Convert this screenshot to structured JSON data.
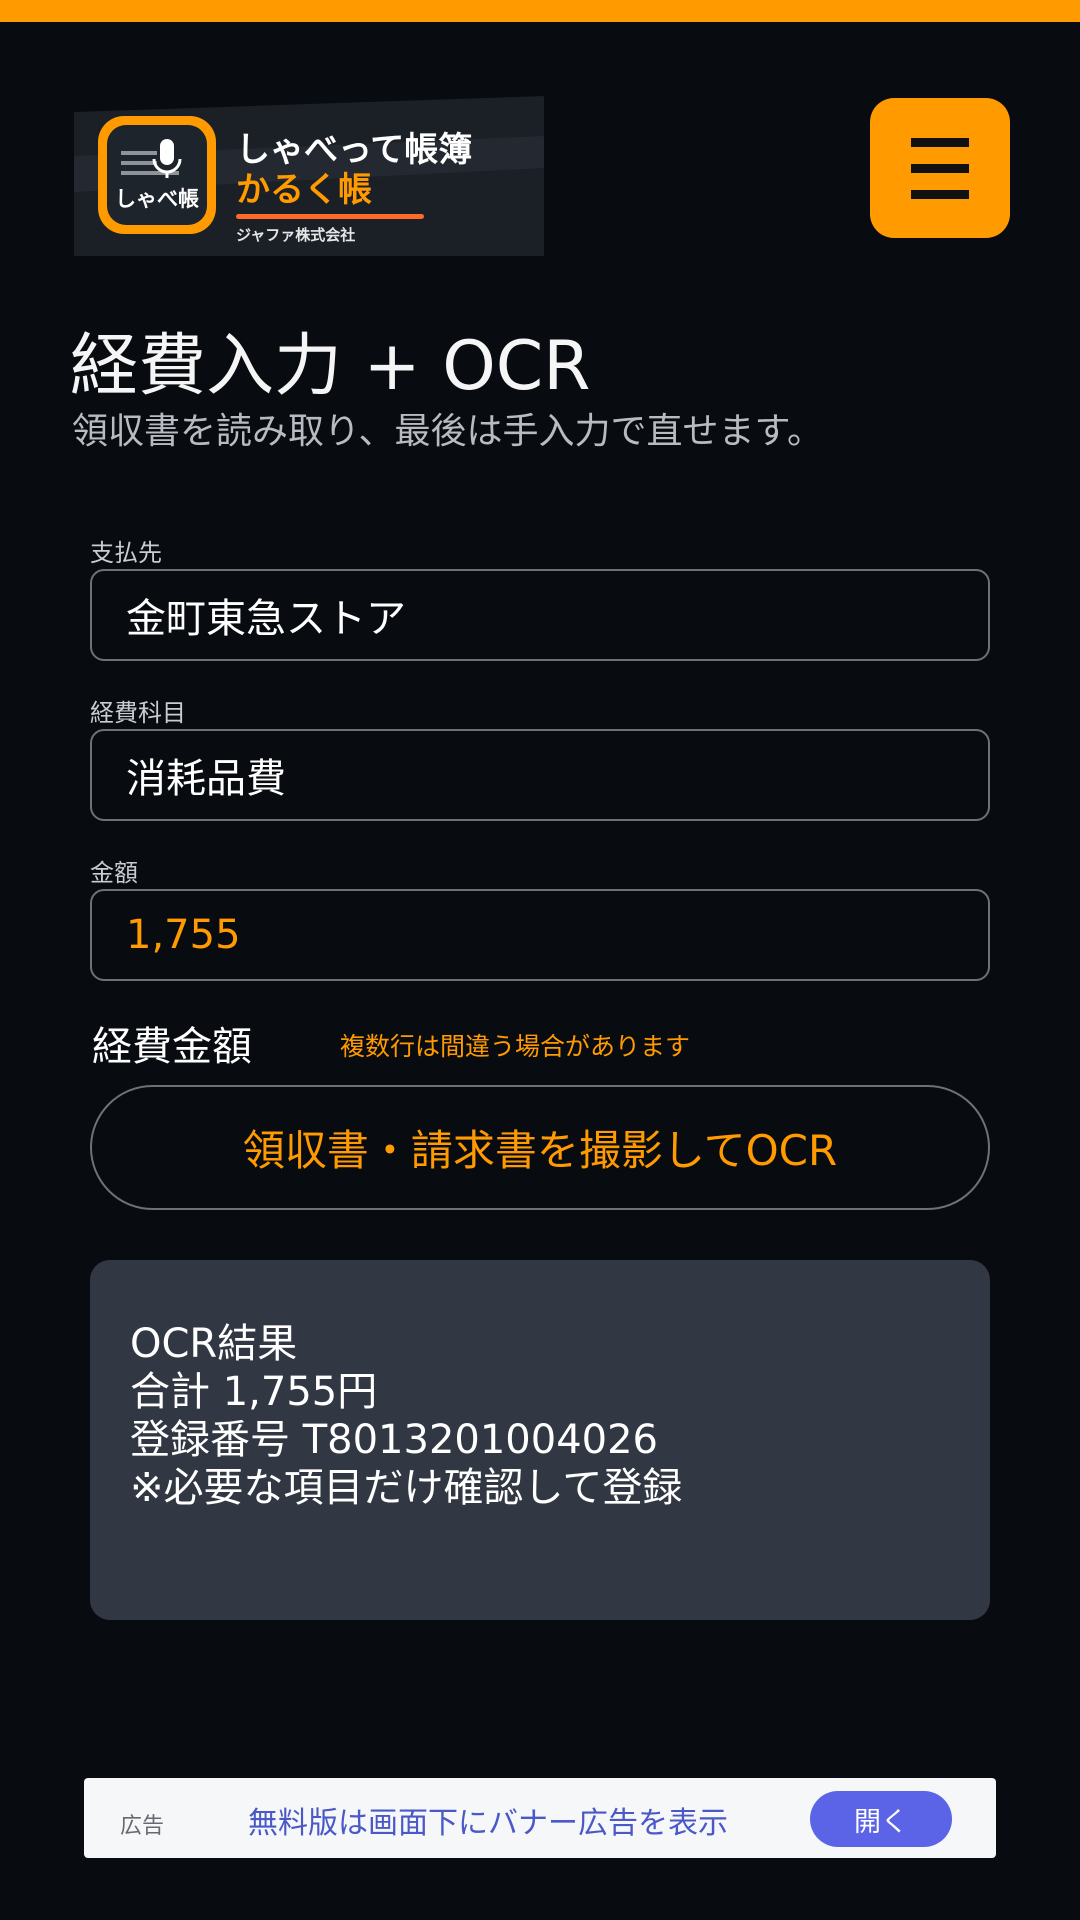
{
  "brand": {
    "icon_text": "しゃべ帳",
    "title": "しゃべって帳簿",
    "subtitle": "かるく帳",
    "company": "ジャファ株式会社"
  },
  "header": {
    "menu_icon": "hamburger-menu-icon"
  },
  "page": {
    "title": "経費入力 + OCR",
    "subtitle": "領収書を読み取り、最後は手入力で直せます。"
  },
  "form": {
    "payee": {
      "label": "支払先",
      "value": "金町東急ストア"
    },
    "category": {
      "label": "経費科目",
      "value": "消耗品費"
    },
    "amount": {
      "label": "金額",
      "value": "1,755"
    }
  },
  "ocr": {
    "section_label": "経費金額",
    "warning": "複数行は間違う場合があります",
    "button_label": "領収書・請求書を撮影してOCR",
    "result_lines": [
      "OCR結果",
      "合計 1,755円",
      "登録番号 T8013201004026",
      "※必要な項目だけ確認して登録"
    ]
  },
  "ad": {
    "label": "広告",
    "text": "無料版は画面下にバナー広告を表示",
    "open_label": "開く"
  },
  "colors": {
    "accent": "#ff9a00",
    "background": "#080b10",
    "result_panel": "#323843",
    "ad_button": "#5b63e6"
  }
}
